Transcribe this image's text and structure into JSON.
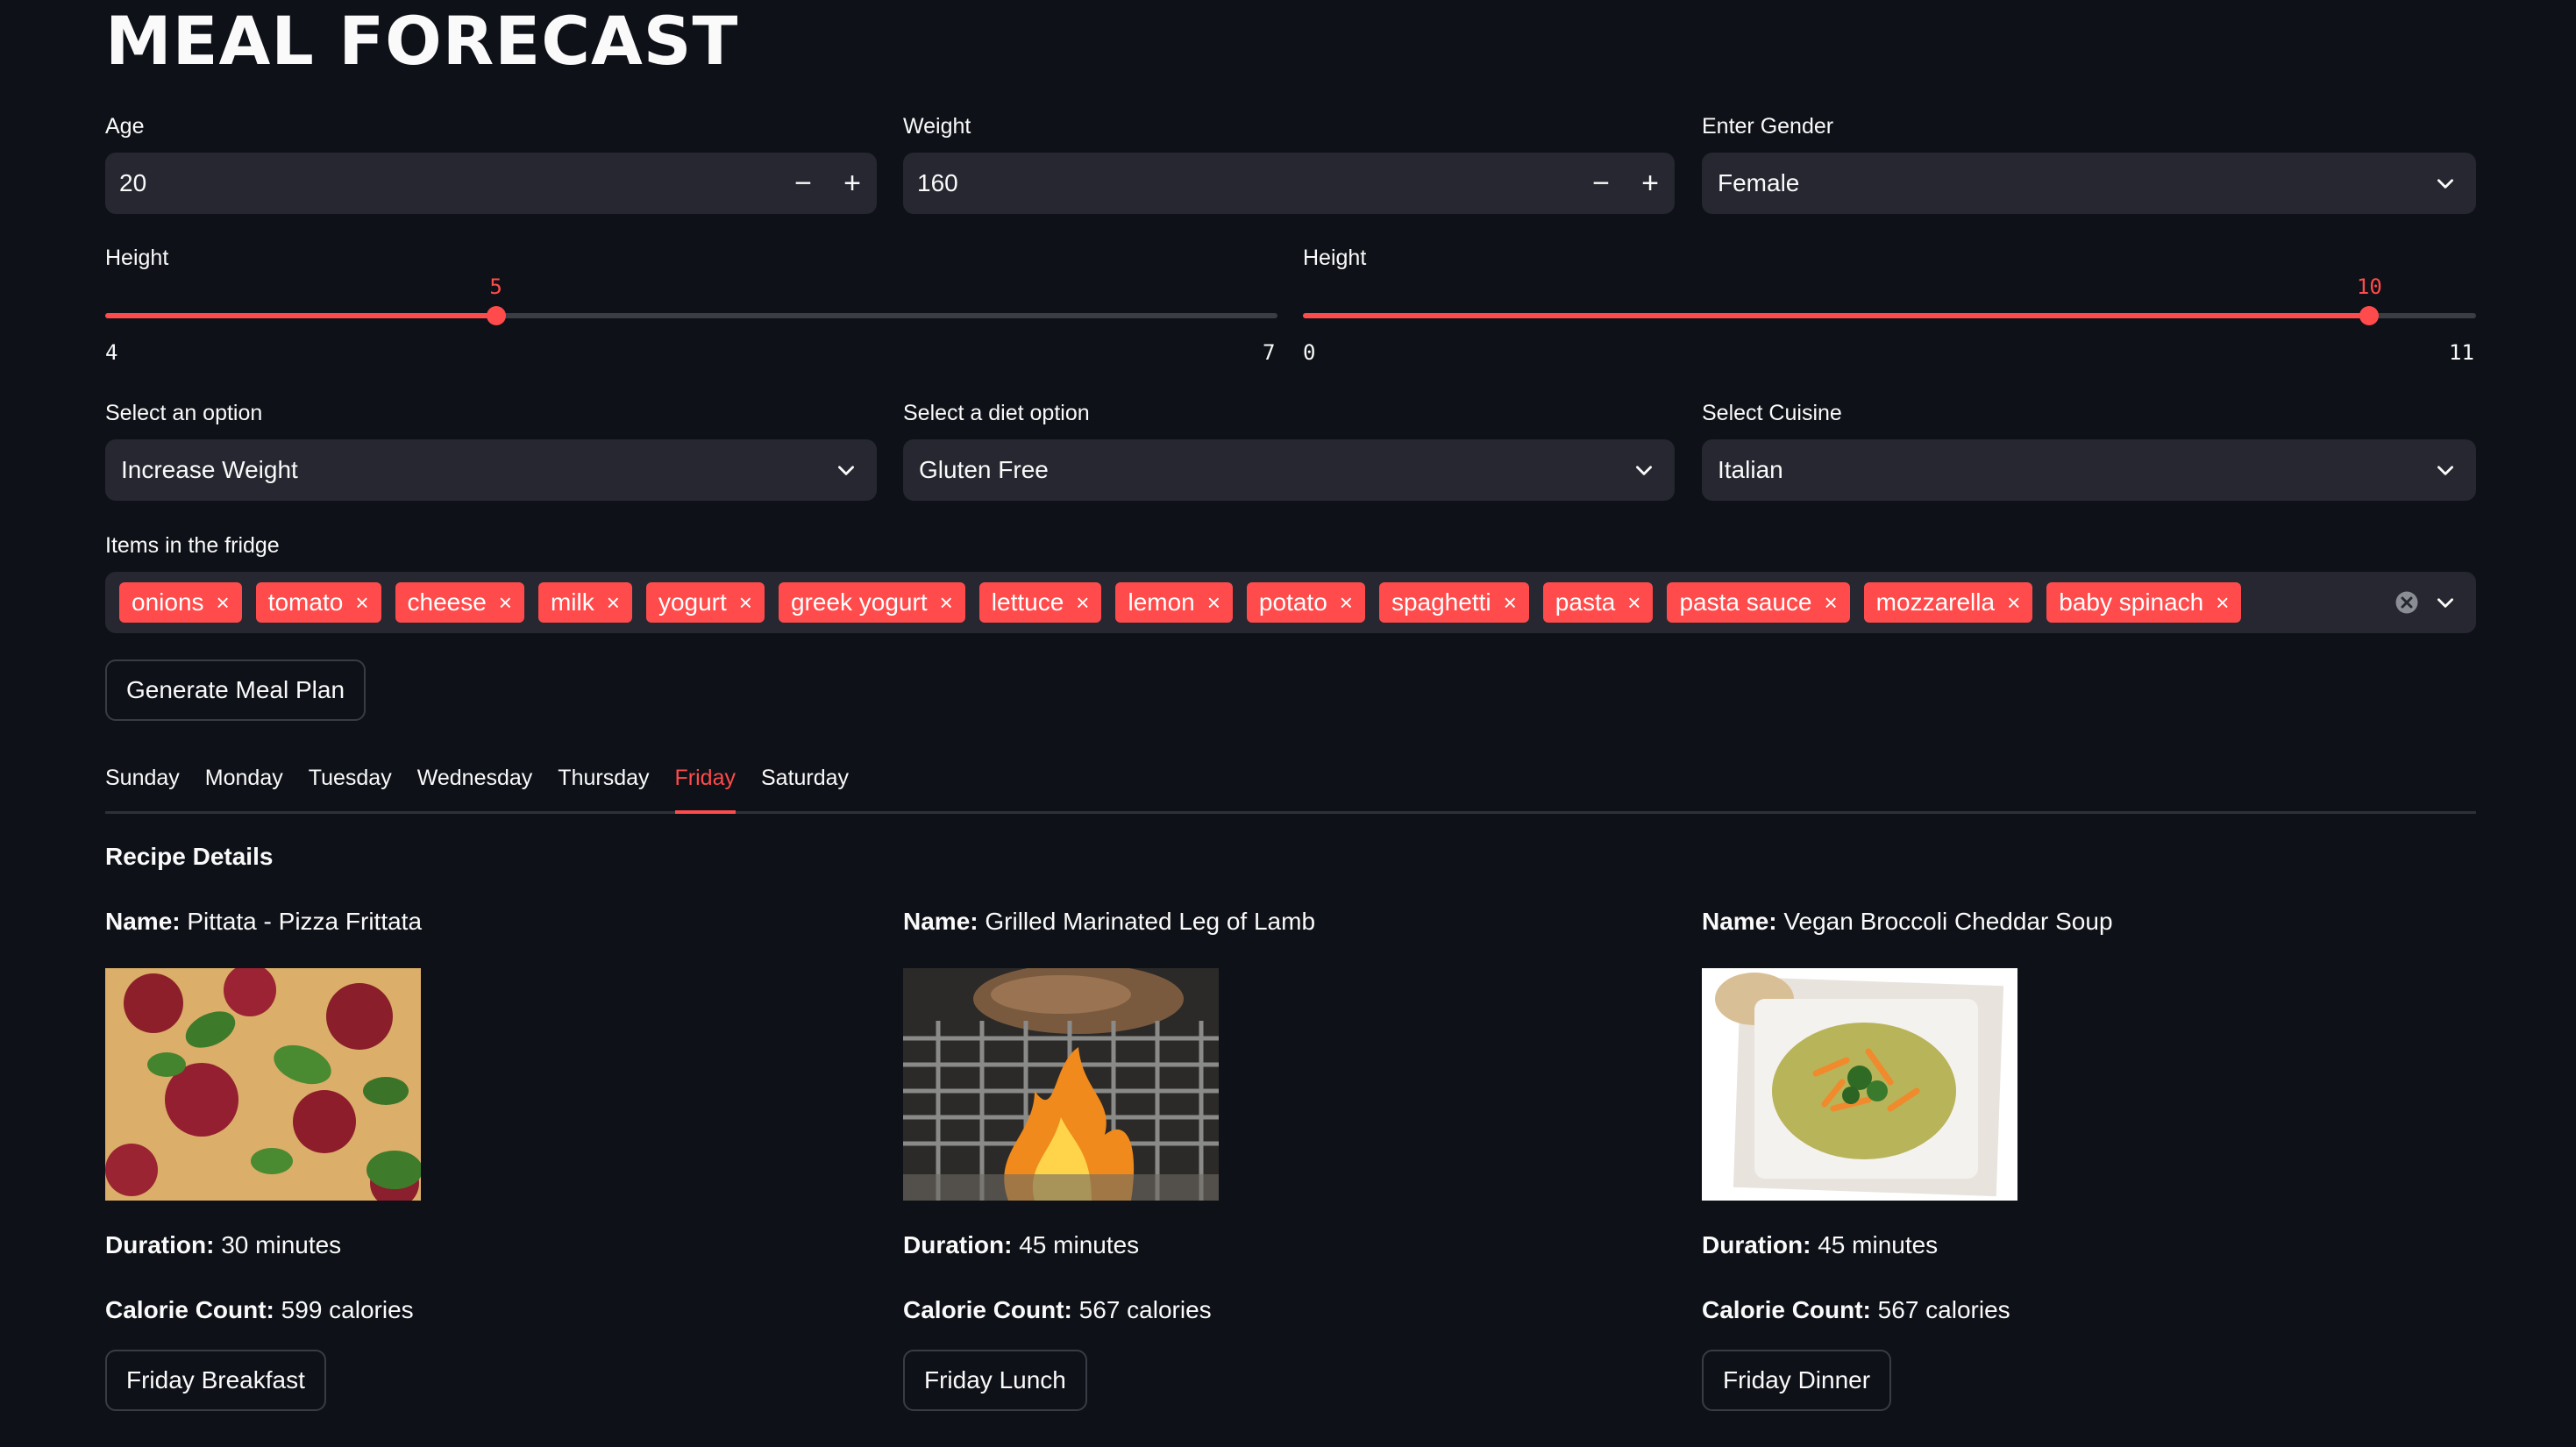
{
  "app": {
    "title": "MEAL FORECAST"
  },
  "inputs": {
    "age": {
      "label": "Age",
      "value": "20",
      "minus": "−",
      "plus": "+"
    },
    "weight": {
      "label": "Weight",
      "value": "160",
      "minus": "−",
      "plus": "+"
    },
    "gender": {
      "label": "Enter Gender",
      "value": "Female"
    }
  },
  "sliders": {
    "height_feet": {
      "label": "Height",
      "value": "5",
      "min": "4",
      "max": "7",
      "fraction": 0.3333
    },
    "height_inches": {
      "label": "Height",
      "value": "10",
      "min": "0",
      "max": "11",
      "fraction": 0.9091
    }
  },
  "selects": {
    "goal": {
      "label": "Select an option",
      "value": "Increase Weight"
    },
    "diet": {
      "label": "Select a diet option",
      "value": "Gluten Free"
    },
    "cuisine": {
      "label": "Select Cuisine",
      "value": "Italian"
    }
  },
  "fridge": {
    "label": "Items in the fridge",
    "items": [
      "onions",
      "tomato",
      "cheese",
      "milk",
      "yogurt",
      "greek yogurt",
      "lettuce",
      "lemon",
      "potato",
      "spaghetti",
      "pasta",
      "pasta sauce",
      "mozzarella",
      "baby spinach"
    ],
    "remove_glyph": "×"
  },
  "generate_button": "Generate Meal Plan",
  "tabs": [
    "Sunday",
    "Monday",
    "Tuesday",
    "Wednesday",
    "Thursday",
    "Friday",
    "Saturday"
  ],
  "active_tab": "Friday",
  "recipe_heading": "Recipe Details",
  "meals": [
    {
      "name_label": "Name:",
      "name": "Pittata - Pizza Frittata",
      "duration_label": "Duration:",
      "duration": "30 minutes",
      "calorie_label": "Calorie Count:",
      "calories": "599 calories",
      "button": "Friday Breakfast"
    },
    {
      "name_label": "Name:",
      "name": "Grilled Marinated Leg of Lamb",
      "duration_label": "Duration:",
      "duration": "45 minutes",
      "calorie_label": "Calorie Count:",
      "calories": "567 calories",
      "button": "Friday Lunch"
    },
    {
      "name_label": "Name:",
      "name": "Vegan Broccoli Cheddar Soup",
      "duration_label": "Duration:",
      "duration": "45 minutes",
      "calorie_label": "Calorie Count:",
      "calories": "567 calories",
      "button": "Friday Dinner"
    }
  ],
  "colors": {
    "background": "#0e1117",
    "field": "#262730",
    "accent": "#ff4b4b",
    "text": "#fafafa"
  }
}
